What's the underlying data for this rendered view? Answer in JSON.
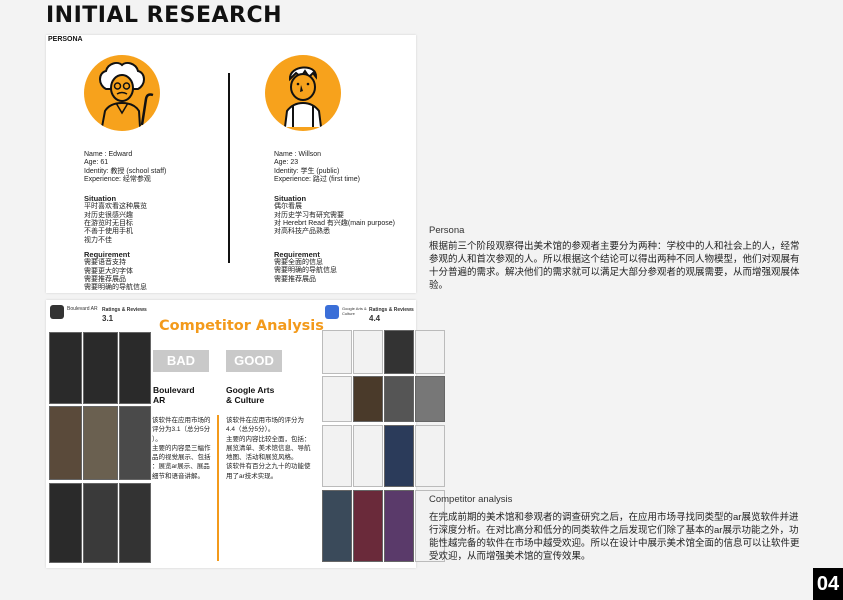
{
  "header": {
    "title": "INITIAL RESEARCH"
  },
  "persona_card": {
    "label": "PERSONA",
    "left": {
      "name": "Name : Edward",
      "age": "Age: 61",
      "identity": "Identity: 教授 (school staff)",
      "experience": "Experience: 经常参观",
      "situation_title": "Situation",
      "situation": [
        "平时喜欢看这种展览",
        "对历史很感兴趣",
        "在游览时无目标",
        "不善于使用手机",
        "视力不佳"
      ],
      "requirement_title": "Requirement",
      "requirement": [
        "需要语音支持",
        "需要更大的字体",
        "需要推荐展品",
        "需要明确的导航信息"
      ]
    },
    "right": {
      "name": "Name : Willson",
      "age": "Age: 23",
      "identity": "Identity: 学生 (public)",
      "experience": "Experience: 路过 (first time)",
      "situation_title": "Situation",
      "situation": [
        "偶尔看展",
        "对历史学习有研究需要",
        "对 Herebrt Read 有兴趣(main purpose)",
        "对高科技产品熟悉"
      ],
      "requirement_title": "Requirement",
      "requirement": [
        "需要全面的信息",
        "需要明确的导航信息",
        "需要推荐展品"
      ]
    }
  },
  "competitor_card": {
    "title": "Competitor Analysis",
    "bad_label": "BAD",
    "good_label": "GOOD",
    "bad_app": {
      "name_line1": "Boulevard",
      "name_line2": "AR",
      "desc": [
        "该软件在应用市场的",
        "评分为3.1（总分5分",
        "）。",
        "主要的内容是三幅作",
        "品的视觉展示、包括",
        "：展览ar展示、展品",
        "细节和语音讲解。"
      ],
      "store_title": "Boulevard AR",
      "store_rating_label": "Ratings & Reviews",
      "store_rating": "3.1"
    },
    "good_app": {
      "name_line1": "Google Arts",
      "name_line2": "& Culture",
      "desc": [
        "该软件在应用市场的评分为",
        "4.4（总分5分）。",
        "主要的内容比较全面，包括：",
        "展览清单、美术馆信息、导航",
        "地图、活动和展览风格。",
        "该软件有百分之九十的功能使",
        "用了ar技术实现。"
      ],
      "store_title": "Google Arts & Culture",
      "store_rating_label": "Ratings & Reviews",
      "store_rating": "4.4"
    }
  },
  "side_text": {
    "persona_heading": "Persona",
    "persona_body": "根据前三个阶段观察得出美术馆的参观者主要分为两种：学校中的人和社会上的人，经常参观的人和首次参观的人。所以根据这个结论可以得出两种不同人物模型，他们对观展有十分普遍的需求。解决他们的需求就可以满足大部分参观者的观展需要，从而增强观展体验。",
    "competitor_heading": "Competitor analysis",
    "competitor_body": "在完成前期的美术馆和参观者的调查研究之后，在应用市场寻找同类型的ar展览软件并进行深度分析。在对比高分和低分的同类软件之后发现它们除了基本的ar展示功能之外，功能性越完备的软件在市场中越受欢迎。所以在设计中展示美术馆全面的信息可以让软件更受欢迎，从而增强美术馆的宣传效果。"
  },
  "page_number": "04",
  "colors": {
    "accent": "#f39a1b",
    "avatar": "#f7a21c",
    "badge": "#c9c9c9"
  }
}
